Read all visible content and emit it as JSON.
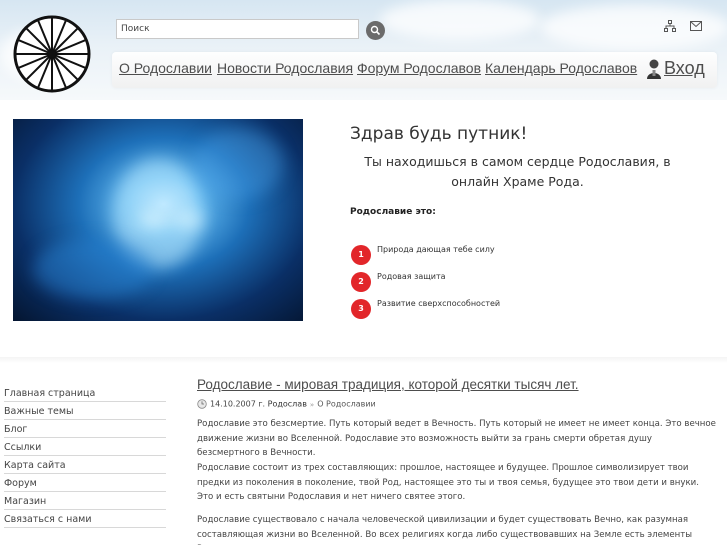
{
  "header": {
    "search": {
      "placeholder": "Поиск"
    },
    "icons": {
      "sitemap": "sitemap-icon",
      "mail": "mail-icon",
      "search": "search-icon",
      "logo": "wheel-logo"
    },
    "nav": [
      {
        "label": "О Родославии"
      },
      {
        "label": "Новости Родославия"
      },
      {
        "label": "Форум Родославов"
      },
      {
        "label": "Календарь Родославов"
      }
    ],
    "login": {
      "label": "Вход",
      "icon": "user-icon"
    }
  },
  "hero": {
    "title": "Здрав будь путник!",
    "subtitle": "Ты находишься в самом сердце Родославия, в онлайн Храме Рода.",
    "heading": "Родославие это:",
    "points": [
      {
        "num": "1",
        "label": "Природа дающая тебе силу"
      },
      {
        "num": "2",
        "label": "Родовая защита"
      },
      {
        "num": "3",
        "label": "Развитие сверхспособностей"
      }
    ],
    "accent_color": "#e2262a"
  },
  "sidebar": {
    "items": [
      {
        "label": "Главная страница"
      },
      {
        "label": "Важные темы"
      },
      {
        "label": "Блог"
      },
      {
        "label": "Ссылки"
      },
      {
        "label": "Карта сайта"
      },
      {
        "label": "Форум"
      },
      {
        "label": "Магазин"
      },
      {
        "label": "Связаться с нами"
      }
    ]
  },
  "article": {
    "title": "Родославие - мировая традиция, которой десятки тысяч лет.",
    "date": "14.10.2007 г.",
    "author": "Родослав",
    "category": "О Родославии",
    "paragraphs": [
      "Родославие это безсмертие. Путь который ведет в Вечность. Путь который не имеет не имеет конца. Это вечное движение жизни во Вселенной. Родославие это возможность выйти за грань смерти обретая душу безсмертного в Вечности.",
      "Родославие состоит из трех составляющих: прошлое, настоящее и будущее. Прошлое символизирует твои предки из поколения в поколение, твой Род, настоящее это ты и твоя семья, будущее это твои дети и внуки. Это и есть святыни Родославия и нет ничего святее этого.",
      "Родославие существовало с начала человеческой цивилизации и будет существовать Вечно, как разумная составляющая жизни во Вселенной. Во всех религиях когда либо существовавших на Земле есть элементы Родославия - это поклонение"
    ]
  }
}
